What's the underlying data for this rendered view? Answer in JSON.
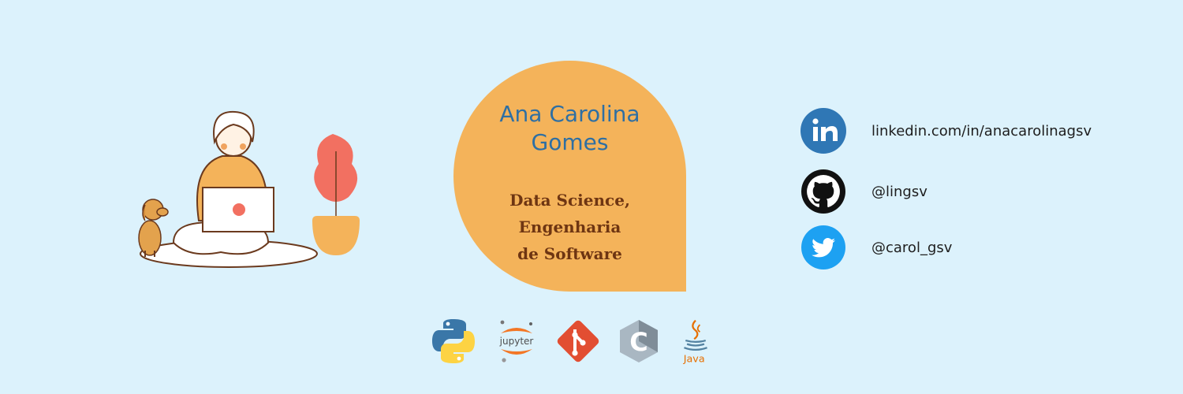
{
  "profile": {
    "name": "Ana Carolina\nGomes",
    "role": "Data Science,\nEngenharia\nde Software"
  },
  "social": [
    {
      "icon": "linkedin-icon",
      "text": "linkedin.com/in/anacarolinagsv"
    },
    {
      "icon": "github-icon",
      "text": " @lingsv"
    },
    {
      "icon": "twitter-icon",
      "text": "@carol_gsv"
    }
  ],
  "tech": {
    "jupyter_label": "jupyter",
    "java_label": "Java",
    "c_letter": "C"
  },
  "colors": {
    "background": "#dcf2fc",
    "bubble": "#f4b35a",
    "name": "#2e6fa3",
    "role": "#6e3512",
    "linkedin": "#2f77b5",
    "twitter": "#1da1f2",
    "git": "#e24e32"
  }
}
